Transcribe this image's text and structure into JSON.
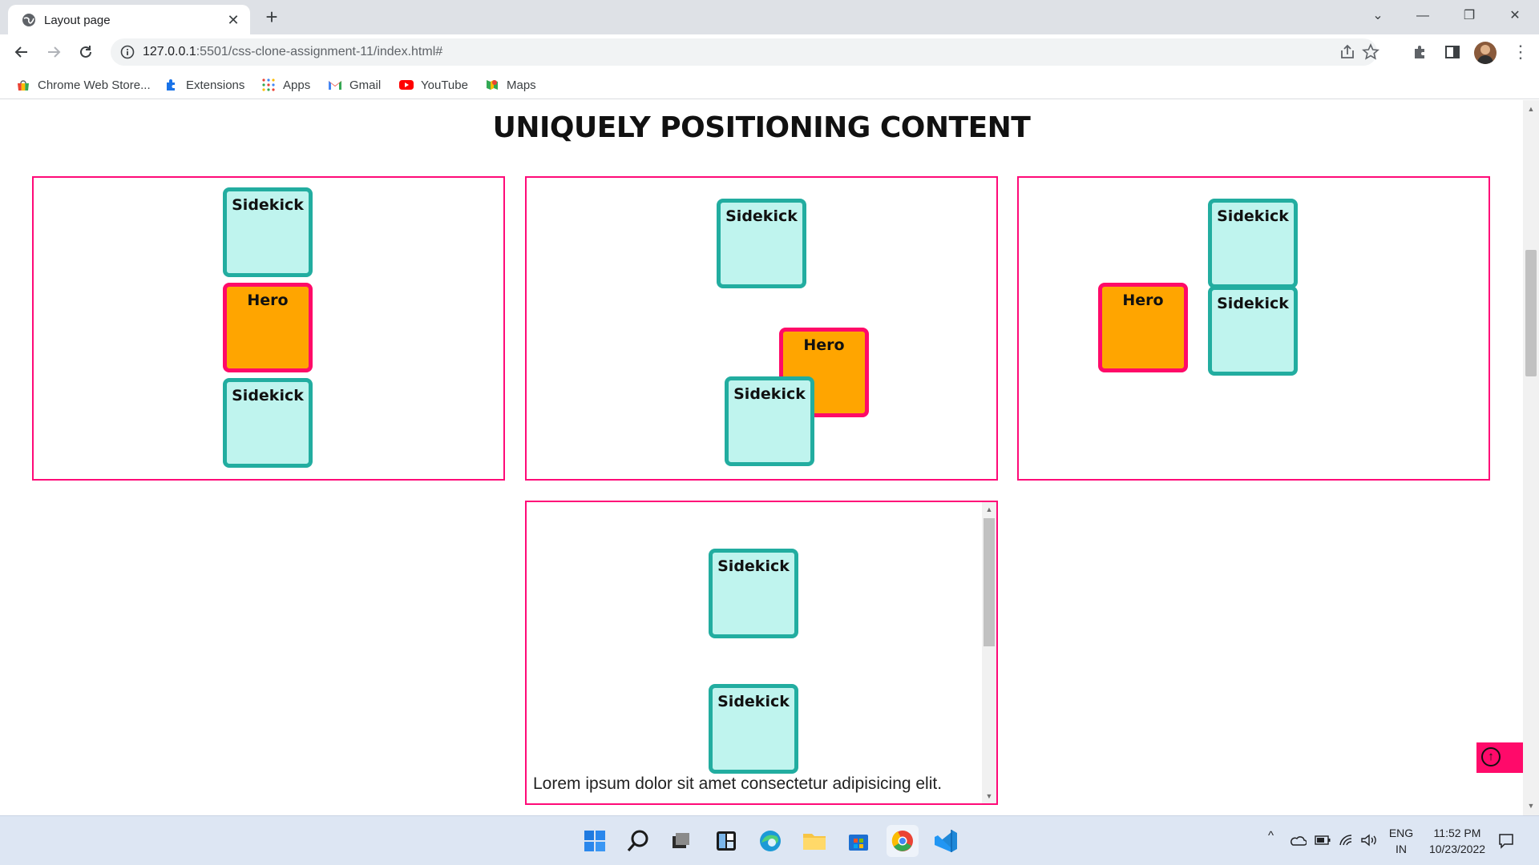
{
  "browser": {
    "tab_title": "Layout page",
    "tab_close": "✕",
    "new_tab": "+",
    "url_host": "127.0.0.1",
    "url_rest": ":5501/css-clone-assignment-11/index.html#",
    "window_controls": {
      "dropdown": "⌄",
      "minimize": "—",
      "restore": "❐",
      "close": "✕"
    },
    "bookmarks": [
      {
        "label": "Chrome Web Store...",
        "icon": "chrome-webstore-icon"
      },
      {
        "label": "Extensions",
        "icon": "puzzle-icon"
      },
      {
        "label": "Apps",
        "icon": "apps-grid-icon"
      },
      {
        "label": "Gmail",
        "icon": "gmail-icon"
      },
      {
        "label": "YouTube",
        "icon": "youtube-icon"
      },
      {
        "label": "Maps",
        "icon": "maps-icon"
      }
    ]
  },
  "page": {
    "title": "UNIQUELY POSITIONING CONTENT",
    "sidekick_label": "Sidekick",
    "hero_label": "Hero",
    "lorem": "Lorem ipsum dolor sit amet consectetur adipisicing elit.",
    "back_to_top": "↑"
  },
  "taskbar": {
    "language": "ENG",
    "region": "IN",
    "time": "11:52 PM",
    "date": "10/23/2022",
    "apps": [
      "windows-start-icon",
      "search-icon",
      "task-view-icon",
      "widgets-icon",
      "edge-icon",
      "file-explorer-icon",
      "store-icon",
      "chrome-icon",
      "vscode-icon"
    ]
  },
  "colors": {
    "panel_border": "#ff0a78",
    "sidekick_fill": "#bff4ee",
    "sidekick_border": "#22ada0",
    "hero_fill": "#ffa500",
    "hero_border": "#ff0a68"
  }
}
